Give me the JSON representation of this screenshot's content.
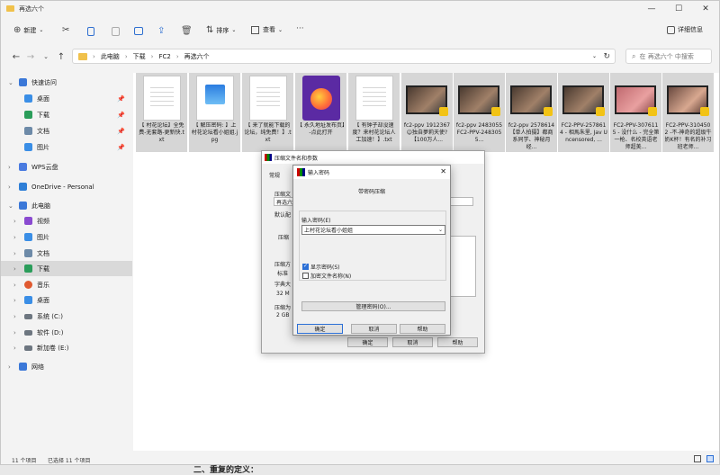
{
  "window": {
    "title": "再选六个"
  },
  "toolbar": {
    "new": "新建",
    "sort": "排序",
    "view": "查看",
    "more": "···",
    "details": "详细信息"
  },
  "address": {
    "segments": [
      "此电脑",
      "下载",
      "FC2",
      "再选六个"
    ],
    "search_placeholder": "在 再选六个 中搜索"
  },
  "sidebar": {
    "items": [
      {
        "label": "快速访问",
        "chev": "⌄",
        "color": "#3b78d8"
      },
      {
        "label": "桌面",
        "color": "#3a8ee6",
        "pin": true
      },
      {
        "label": "下载",
        "color": "#2a9d5a",
        "pin": true
      },
      {
        "label": "文档",
        "color": "#6d8aa8",
        "pin": true
      },
      {
        "label": "图片",
        "color": "#3a8ee6",
        "pin": true
      },
      {
        "label": "WPS云盘",
        "chev": "›",
        "color": "#4a7be0"
      },
      {
        "label": "OneDrive - Personal",
        "chev": "›",
        "color": "#2f7fd7"
      },
      {
        "label": "此电脑",
        "chev": "⌄",
        "color": "#3b78d8"
      },
      {
        "label": "视频",
        "chev": "›",
        "color": "#8a4ad0"
      },
      {
        "label": "图片",
        "chev": "›",
        "color": "#3a8ee6"
      },
      {
        "label": "文档",
        "chev": "›",
        "color": "#6d8aa8"
      },
      {
        "label": "下载",
        "chev": "›",
        "color": "#2a9d5a"
      },
      {
        "label": "音乐",
        "chev": "›",
        "color": "#e05a30"
      },
      {
        "label": "桌面",
        "chev": "›",
        "color": "#3a8ee6"
      },
      {
        "label": "系统 (C:)",
        "chev": "›",
        "color": "#6d7680"
      },
      {
        "label": "软件 (D:)",
        "chev": "›",
        "color": "#6d7680"
      },
      {
        "label": "新加卷 (E:)",
        "chev": "›",
        "color": "#6d7680"
      },
      {
        "label": "网络",
        "chev": "›",
        "color": "#3b78d8"
      }
    ]
  },
  "files": [
    {
      "type": "doc",
      "caption": "【 村花论坛】全免费-无套路-更新快.txt"
    },
    {
      "type": "img",
      "caption": "【 解压密码: 】上村花论坛看小姐姐.jpg"
    },
    {
      "type": "doc",
      "caption": "【 来了就能下载的论坛，纯免费！】.txt"
    },
    {
      "type": "ff",
      "caption": "【 永久地址发布页】-点此打开"
    },
    {
      "type": "doc",
      "caption": "【 有钟子却没速度？来村花论坛人工加速！】.txt"
    },
    {
      "type": "vid",
      "caption": "fc2-ppv 1912367 ☺独自夢莉天使?【100万人..."
    },
    {
      "type": "vid",
      "caption": "fc2-ppv 2483055 FC2-PPV-2483055..."
    },
    {
      "type": "vid",
      "caption": "fc2-ppv 2578614 【单人拍摄】都商系同学、神秘月经..."
    },
    {
      "type": "vid",
      "caption": "FC2-PPV-2578614 - 相馬朱里, Jav Uncensored, ..."
    },
    {
      "type": "vid",
      "caption": "FC2-PPV-3076115 - 没什么 - 完全第一枪、名校英语老师超美..."
    },
    {
      "type": "vid",
      "caption": "FC2-PPV-3104502 -不-神奇的超级牛奶K杯！有名的补习班老师..."
    }
  ],
  "status": {
    "count": "11 个项目",
    "selected": "已选择 11 个项目"
  },
  "compress_dialog": {
    "title": "压缩文件名和参数",
    "tab_general": "常规",
    "label_name": "压缩文",
    "name_value": "再选六个",
    "label_default": "默认配",
    "label_format": "压缩",
    "label_method": "压缩方",
    "method_value": "标准",
    "label_dict": "字典大",
    "dict_value": "32 M",
    "label_split": "压缩为",
    "split_value": "2 GB",
    "ok": "确定",
    "cancel": "取消",
    "help": "帮助"
  },
  "password_dialog": {
    "title": "输入密码",
    "heading": "带密码压缩",
    "label_input": "输入密码(E)",
    "password_value": "上村花论坛看小姐姐",
    "show_password": "显示密码(S)",
    "encrypt_names": "加密文件名称(N)",
    "manage": "管理密码(O)...",
    "ok": "确定",
    "cancel": "取消",
    "help": "帮助"
  },
  "below_text": "二、重复的定义："
}
